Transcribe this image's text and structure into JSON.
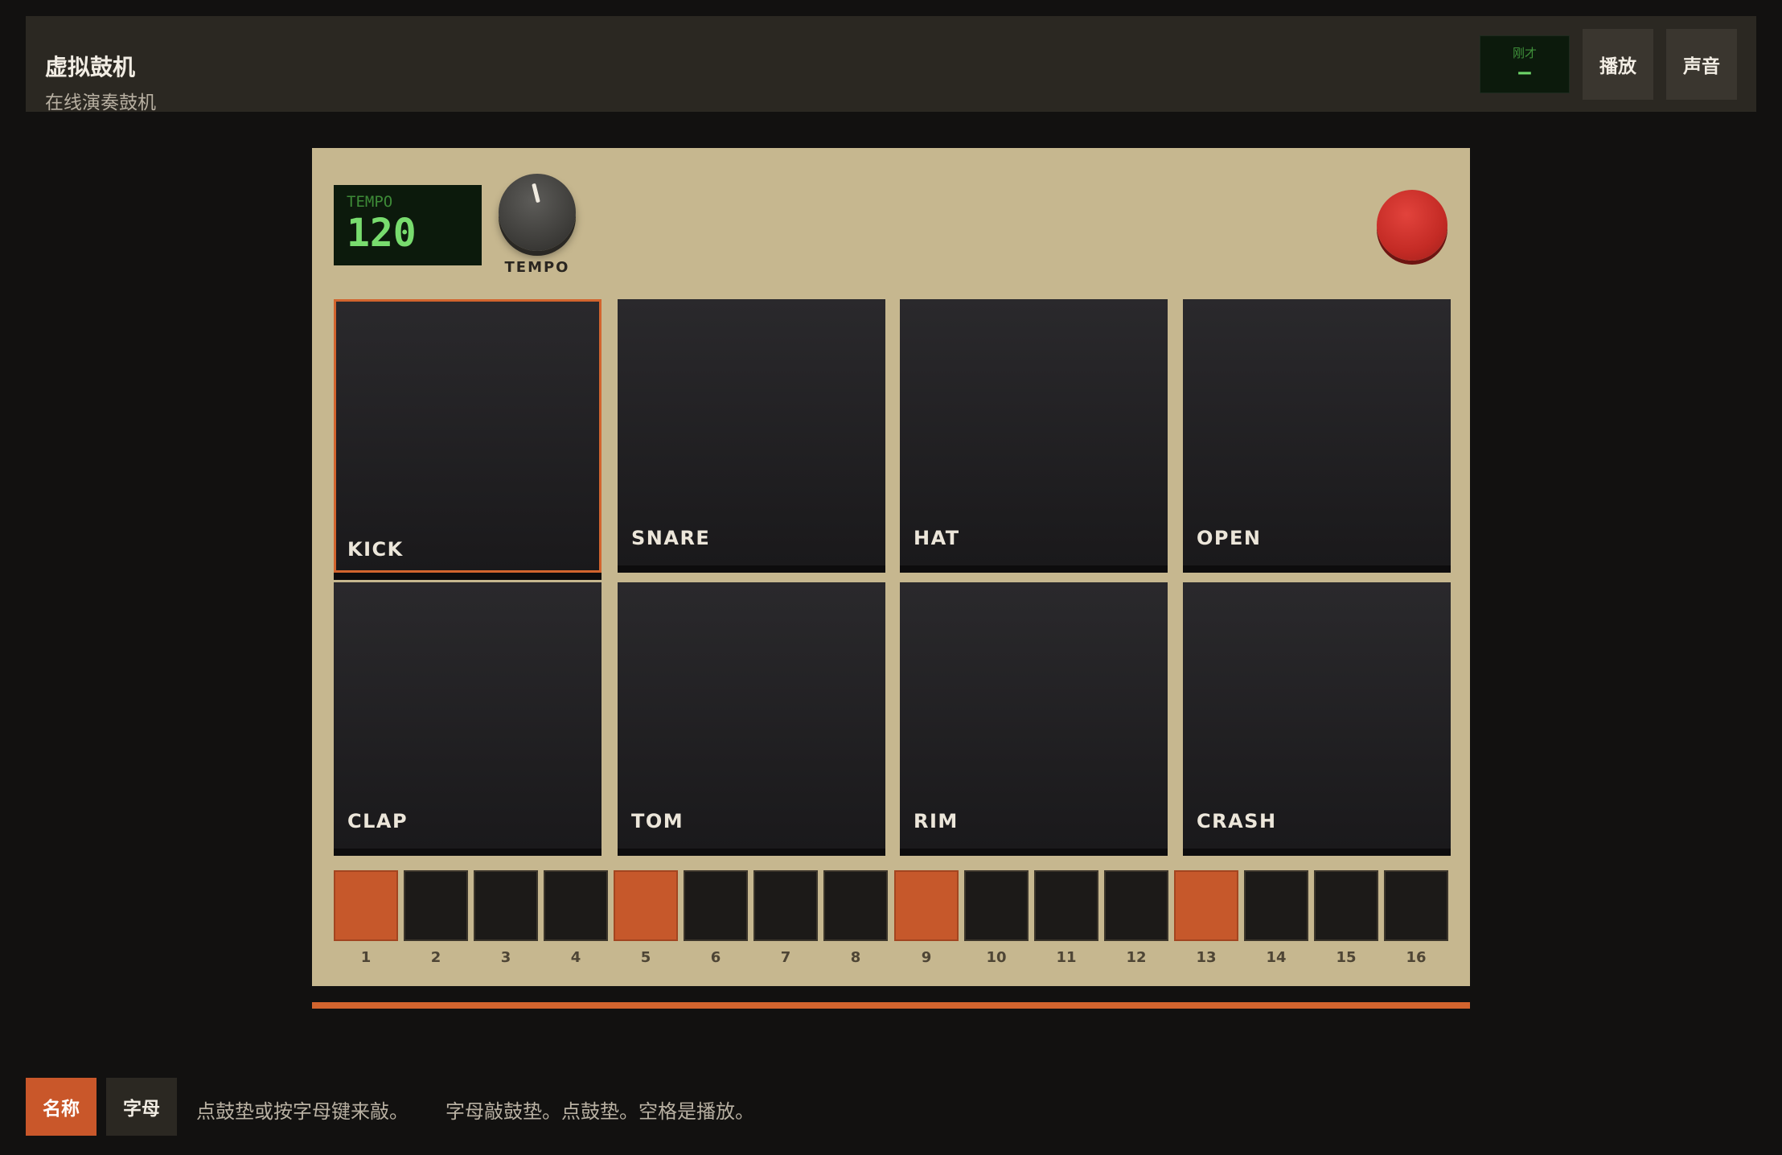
{
  "header": {
    "title": "虚拟鼓机",
    "subtitle": "在线演奏鼓机",
    "last_hit_label": "刚才",
    "last_hit_value": "–",
    "play_label": "播放",
    "sound_label": "声音"
  },
  "machine": {
    "lcd_label": "TEMPO",
    "tempo": "120",
    "knob_label": "TEMPO",
    "pads": [
      {
        "name": "KICK",
        "active": true
      },
      {
        "name": "SNARE",
        "active": false
      },
      {
        "name": "HAT",
        "active": false
      },
      {
        "name": "OPEN",
        "active": false
      },
      {
        "name": "CLAP",
        "active": false
      },
      {
        "name": "TOM",
        "active": false
      },
      {
        "name": "RIM",
        "active": false
      },
      {
        "name": "CRASH",
        "active": false
      }
    ],
    "steps": [
      {
        "n": "1",
        "on": true
      },
      {
        "n": "2",
        "on": false
      },
      {
        "n": "3",
        "on": false
      },
      {
        "n": "4",
        "on": false
      },
      {
        "n": "5",
        "on": true
      },
      {
        "n": "6",
        "on": false
      },
      {
        "n": "7",
        "on": false
      },
      {
        "n": "8",
        "on": false
      },
      {
        "n": "9",
        "on": true
      },
      {
        "n": "10",
        "on": false
      },
      {
        "n": "11",
        "on": false
      },
      {
        "n": "12",
        "on": false
      },
      {
        "n": "13",
        "on": true
      },
      {
        "n": "14",
        "on": false
      },
      {
        "n": "15",
        "on": false
      },
      {
        "n": "16",
        "on": false
      }
    ]
  },
  "footer": {
    "names_label": "名称",
    "letters_label": "字母",
    "hint1": "点鼓垫或按字母键来敲。",
    "hint2": "字母敲鼓垫。点鼓垫。空格是播放。"
  },
  "colors": {
    "accent": "#c9572a",
    "panel": "#c6b78f",
    "lcd_text": "#78dc6e",
    "record": "#c42b25"
  }
}
